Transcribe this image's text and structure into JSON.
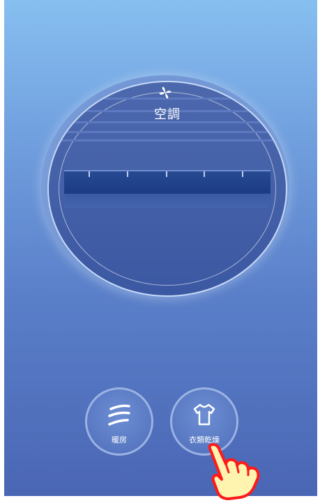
{
  "mode": {
    "title": "空調",
    "icon": "fan-icon"
  },
  "modes": [
    {
      "label": "暖房",
      "icon": "heat-waves-icon"
    },
    {
      "label": "衣類乾燥",
      "icon": "shirt-icon"
    }
  ],
  "colors": {
    "accent": "#4a66b4",
    "pointer": "#ff1a1a"
  }
}
